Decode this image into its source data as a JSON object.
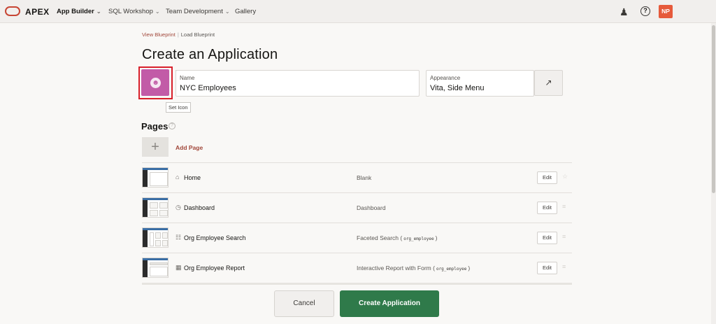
{
  "topbar": {
    "brand": "APEX",
    "nav": [
      {
        "label": "App Builder",
        "active": true
      },
      {
        "label": "SQL Workshop"
      },
      {
        "label": "Team Development"
      },
      {
        "label": "Gallery"
      }
    ],
    "avatar_initials": "NP",
    "icons": {
      "user": "user-admin-icon",
      "help": "help-icon"
    }
  },
  "breadcrumb": {
    "link": "View Blueprint",
    "current": "Load Blueprint"
  },
  "page_title": "Create an Application",
  "app_icon": {
    "color": "#c25ba7",
    "icon": "smiley-icon",
    "tooltip": "Set Icon"
  },
  "form": {
    "name_label": "Name",
    "name_value": "NYC Employees",
    "appearance_label": "Appearance",
    "appearance_value": "Vita, Side Menu"
  },
  "pages_section": {
    "title": "Pages",
    "add_label": "Add Page",
    "rows": [
      {
        "name": "Home",
        "type": "Blank",
        "edit": "Edit",
        "icon": "home-icon"
      },
      {
        "name": "Dashboard",
        "type": "Dashboard",
        "edit": "Edit",
        "icon": "dashboard-icon"
      },
      {
        "name": "Org Employee Search",
        "type": "Faceted Search (",
        "code": "org_employee",
        "type_end": ")",
        "edit": "Edit",
        "icon": "faceted-search-icon"
      },
      {
        "name": "Org Employee Report",
        "type": "Interactive Report with Form (",
        "code": "org_employee",
        "type_end": ")",
        "edit": "Edit",
        "icon": "report-icon"
      }
    ]
  },
  "buttons": {
    "cancel": "Cancel",
    "create": "Create Application"
  }
}
